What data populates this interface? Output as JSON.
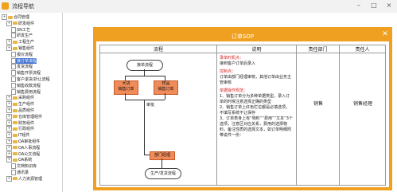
{
  "window": {
    "title": "流程导航"
  },
  "tree": {
    "items": [
      {
        "label": "合同管理",
        "kind": "folder"
      },
      {
        "label": "研发组件",
        "kind": "folder"
      },
      {
        "label": "SN工艺",
        "kind": "doc"
      },
      {
        "label": "研发生产",
        "kind": "doc"
      },
      {
        "label": "工程生产",
        "kind": "folder"
      },
      {
        "label": "销售组件",
        "kind": "folder"
      },
      {
        "label": "报价流程",
        "kind": "doc"
      },
      {
        "label": "接订单流程",
        "kind": "doc",
        "selected": true
      },
      {
        "label": "发货流程",
        "kind": "doc"
      },
      {
        "label": "销售开票流程",
        "kind": "doc"
      },
      {
        "label": "客户退货/折让流程",
        "kind": "doc"
      },
      {
        "label": "销售收款流程",
        "kind": "doc"
      },
      {
        "label": "销售费用流程",
        "kind": "doc"
      },
      {
        "label": "采购组件",
        "kind": "folder"
      },
      {
        "label": "生产组件",
        "kind": "folder"
      },
      {
        "label": "品质组件",
        "kind": "folder"
      },
      {
        "label": "仓库管理组件",
        "kind": "folder"
      },
      {
        "label": "财务组件",
        "kind": "folder"
      },
      {
        "label": "行政组件",
        "kind": "folder"
      },
      {
        "label": "IT组件",
        "kind": "folder"
      },
      {
        "label": "OA审批组件",
        "kind": "folder"
      },
      {
        "label": "OA人事流程",
        "kind": "folder"
      },
      {
        "label": "OA公文流程",
        "kind": "folder"
      },
      {
        "label": "OA系统",
        "kind": "folder"
      },
      {
        "label": "文档知识库",
        "kind": "doc"
      },
      {
        "label": "通讯录",
        "kind": "doc"
      },
      {
        "label": "人力资源管理",
        "kind": "folder"
      }
    ]
  },
  "dialog": {
    "title": "订单SOP",
    "headers": {
      "flow": "流程",
      "desc": "说明",
      "dept": "责任部门",
      "person": "责任人"
    },
    "flow": {
      "start": "接单流程",
      "box1a": "大货",
      "box1b": "销售订单",
      "box2a": "样品",
      "box2b": "销售订单",
      "approve": "审批",
      "mgr": "部门经理",
      "end": "生产/发货流程"
    },
    "desc": {
      "h1": "录单时机点：",
      "p1": "接到客户订单后录入",
      "h2": "控制点：",
      "p2": "订单由部门经理审核，其他订单由业务主管审核",
      "h3": "单据操作规范：",
      "items": [
        "1、销售订单分为多种单据类型，录入订单的时候注意选择正确的类型",
        "2、销售订单上红色栏位都是必填选项，不填写系统不让保存",
        "3、订单表身上有“物料”“费用”“文本”3个选项，注意区对应关系，费用的选择物料，备注性质的选择文本，如订单明细附带说件一份："
      ]
    },
    "dept": "销售",
    "person": "销售经理"
  }
}
